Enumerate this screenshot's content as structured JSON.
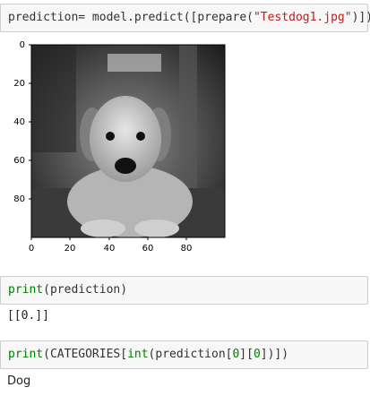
{
  "cells": {
    "predict": {
      "tokens": [
        {
          "t": "prediction",
          "c": "t-var"
        },
        {
          "t": "= model.",
          "c": "t-pun"
        },
        {
          "t": "predict",
          "c": "t-var"
        },
        {
          "t": "([",
          "c": "t-pun"
        },
        {
          "t": "prepare",
          "c": "t-var"
        },
        {
          "t": "(",
          "c": "t-pun"
        },
        {
          "t": "\"Testdog1.jpg\"",
          "c": "t-str"
        },
        {
          "t": ")])",
          "c": "t-pun"
        }
      ]
    },
    "print_prediction": {
      "tokens": [
        {
          "t": "print",
          "c": "t-builtin"
        },
        {
          "t": "(prediction)",
          "c": "t-pun"
        }
      ],
      "output": "[[0.]]"
    },
    "print_category": {
      "tokens": [
        {
          "t": "print",
          "c": "t-builtin"
        },
        {
          "t": "(CATEGORIES[",
          "c": "t-pun"
        },
        {
          "t": "int",
          "c": "t-builtin"
        },
        {
          "t": "(prediction[",
          "c": "t-pun"
        },
        {
          "t": "0",
          "c": "t-num"
        },
        {
          "t": "][",
          "c": "t-pun"
        },
        {
          "t": "0",
          "c": "t-num"
        },
        {
          "t": "])])",
          "c": "t-pun"
        }
      ],
      "output": "Dog"
    }
  },
  "figure": {
    "x_ticks": [
      "0",
      "20",
      "40",
      "60",
      "80"
    ],
    "y_ticks": [
      "0",
      "20",
      "40",
      "60",
      "80"
    ],
    "image_subject": "grayscale dog photo"
  }
}
